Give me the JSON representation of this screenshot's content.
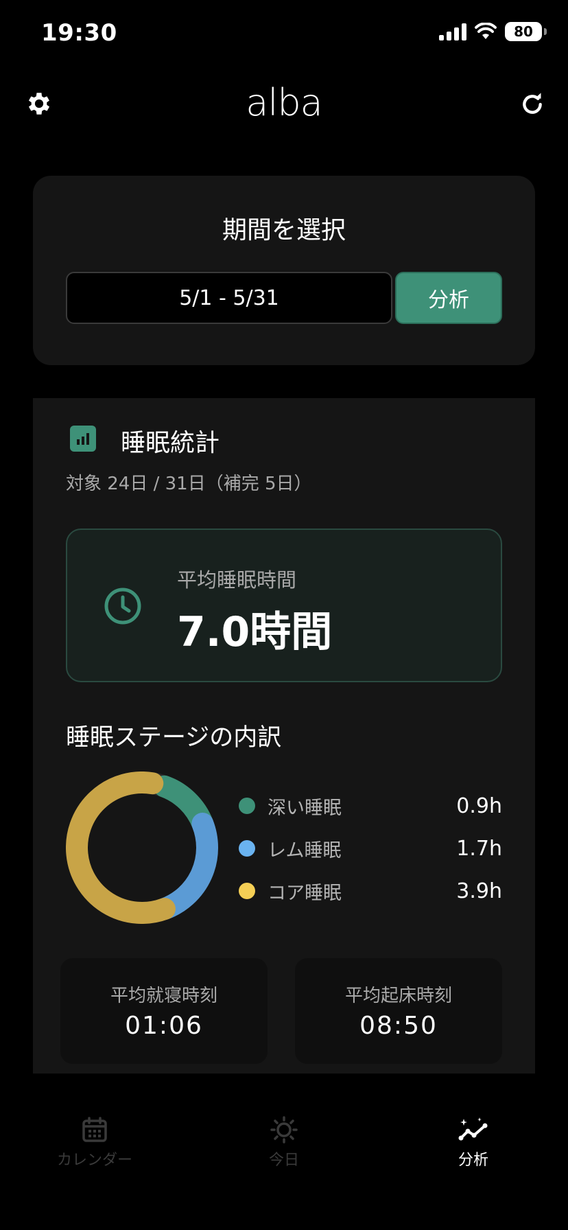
{
  "status": {
    "time": "19:30",
    "battery": "80"
  },
  "header": {
    "logo": "alba"
  },
  "period": {
    "title": "期間を選択",
    "range": "5/1 - 5/31",
    "analyze_label": "分析"
  },
  "stats": {
    "title": "睡眠統計",
    "subtitle": "対象 24日 / 31日（補完 5日）",
    "avg_label": "平均睡眠時間",
    "avg_value": "7.0時間",
    "stage_title": "睡眠ステージの内訳",
    "stages": [
      {
        "label": "深い睡眠",
        "value": "0.9h",
        "hours": 0.9,
        "color": "#3e9178"
      },
      {
        "label": "レム睡眠",
        "value": "1.7h",
        "hours": 1.7,
        "color": "#5b9bd5"
      },
      {
        "label": "コア睡眠",
        "value": "3.9h",
        "hours": 3.9,
        "color": "#c8a447"
      }
    ],
    "bedtime_label": "平均就寝時刻",
    "bedtime_value": "01:06",
    "wake_label": "平均起床時刻",
    "wake_value": "08:50"
  },
  "tabs": [
    {
      "label": "カレンダー"
    },
    {
      "label": "今日"
    },
    {
      "label": "分析"
    }
  ],
  "colors": {
    "accent": "#3e9178",
    "tab_inactive": "#3a3a3a",
    "tab_active": "#ffffff"
  }
}
